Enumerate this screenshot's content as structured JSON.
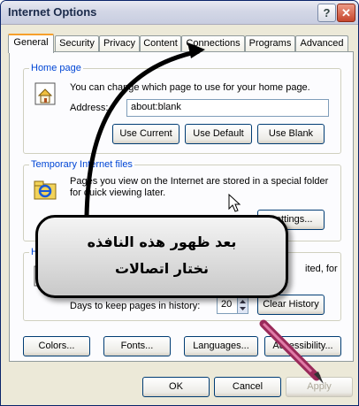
{
  "window": {
    "title": "Internet Options"
  },
  "titlebar": {
    "help_glyph": "?",
    "close_glyph": "✕"
  },
  "tabs": [
    "General",
    "Security",
    "Privacy",
    "Content",
    "Connections",
    "Programs",
    "Advanced"
  ],
  "home_page": {
    "group_label": "Home page",
    "description": "You can change which page to use for your home page.",
    "address_label": "Address:",
    "address_value": "about:blank",
    "use_current": "Use Current",
    "use_default": "Use Default",
    "use_blank": "Use Blank"
  },
  "temp_files": {
    "group_label": "Temporary Internet files",
    "description_line1": "Pages you view on the Internet are stored in a special folder",
    "description_line2": "for quick viewing later.",
    "settings": "Settings..."
  },
  "history": {
    "group_label": "H",
    "description_partial": "ited, for",
    "days_label": "Days to keep pages in history:",
    "days_value": "20",
    "clear_history": "Clear History"
  },
  "bottom_buttons": {
    "colors": "Colors...",
    "fonts": "Fonts...",
    "languages": "Languages...",
    "accessibility": "Accessibility..."
  },
  "dialog_buttons": {
    "ok": "OK",
    "cancel": "Cancel",
    "apply": "Apply"
  },
  "annotation": {
    "line1": "بعد ظهور هذه النافذه",
    "line2": "نختار اتصالات"
  },
  "icons": [
    "help-icon",
    "close-icon",
    "home-page-icon",
    "ie-folder-icon",
    "history-icon",
    "spinner-arrows-icon",
    "mouse-cursor-icon",
    "pen-icon"
  ]
}
